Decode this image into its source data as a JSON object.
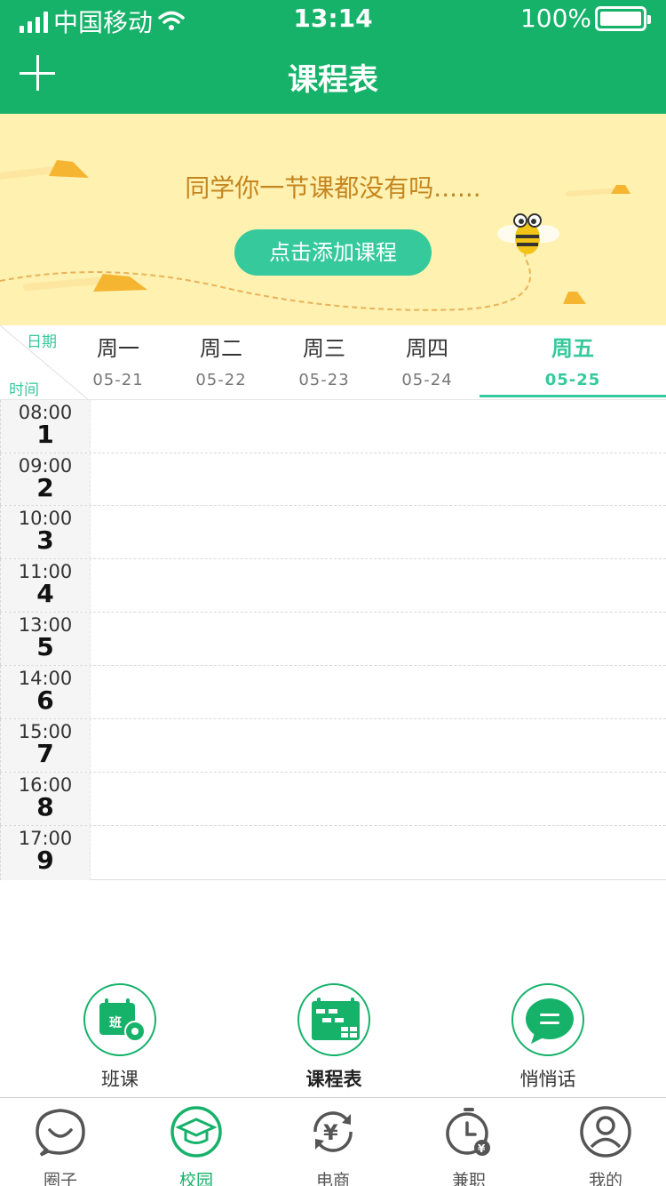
{
  "status_bar": {
    "carrier": "中国移动",
    "time": "13:14",
    "battery": "100%"
  },
  "nav": {
    "title": "课程表",
    "add_icon": "plus-icon"
  },
  "banner": {
    "message": "同学你一节课都没有吗......",
    "add_button": "点击添加课程"
  },
  "week_header": {
    "date_label": "日期",
    "time_label": "时间",
    "days": [
      {
        "name": "周一",
        "date": "05-21"
      },
      {
        "name": "周二",
        "date": "05-22"
      },
      {
        "name": "周三",
        "date": "05-23"
      },
      {
        "name": "周四",
        "date": "05-24"
      },
      {
        "name": "周五",
        "date": "05-25",
        "active": true
      }
    ]
  },
  "periods": [
    {
      "time": "08:00",
      "num": "1"
    },
    {
      "time": "09:00",
      "num": "2"
    },
    {
      "time": "10:00",
      "num": "3"
    },
    {
      "time": "11:00",
      "num": "4"
    },
    {
      "time": "13:00",
      "num": "5"
    },
    {
      "time": "14:00",
      "num": "6"
    },
    {
      "time": "15:00",
      "num": "7"
    },
    {
      "time": "16:00",
      "num": "8"
    },
    {
      "time": "17:00",
      "num": "9"
    }
  ],
  "actions": [
    {
      "label": "班课",
      "icon": "class-settings-icon"
    },
    {
      "label": "课程表",
      "icon": "timetable-icon"
    },
    {
      "label": "悄悄话",
      "icon": "chat-bubble-icon"
    }
  ],
  "tabs": [
    {
      "label": "圈子",
      "icon": "circle-smile-icon"
    },
    {
      "label": "校园",
      "icon": "graduation-cap-icon",
      "active": true
    },
    {
      "label": "电商",
      "icon": "yen-icon"
    },
    {
      "label": "兼职",
      "icon": "clock-yen-icon"
    },
    {
      "label": "我的",
      "icon": "user-icon"
    }
  ],
  "colors": {
    "primary": "#16b26a",
    "accent": "#35c99b",
    "banner_bg": "#fff1b0",
    "banner_text": "#c48620"
  }
}
